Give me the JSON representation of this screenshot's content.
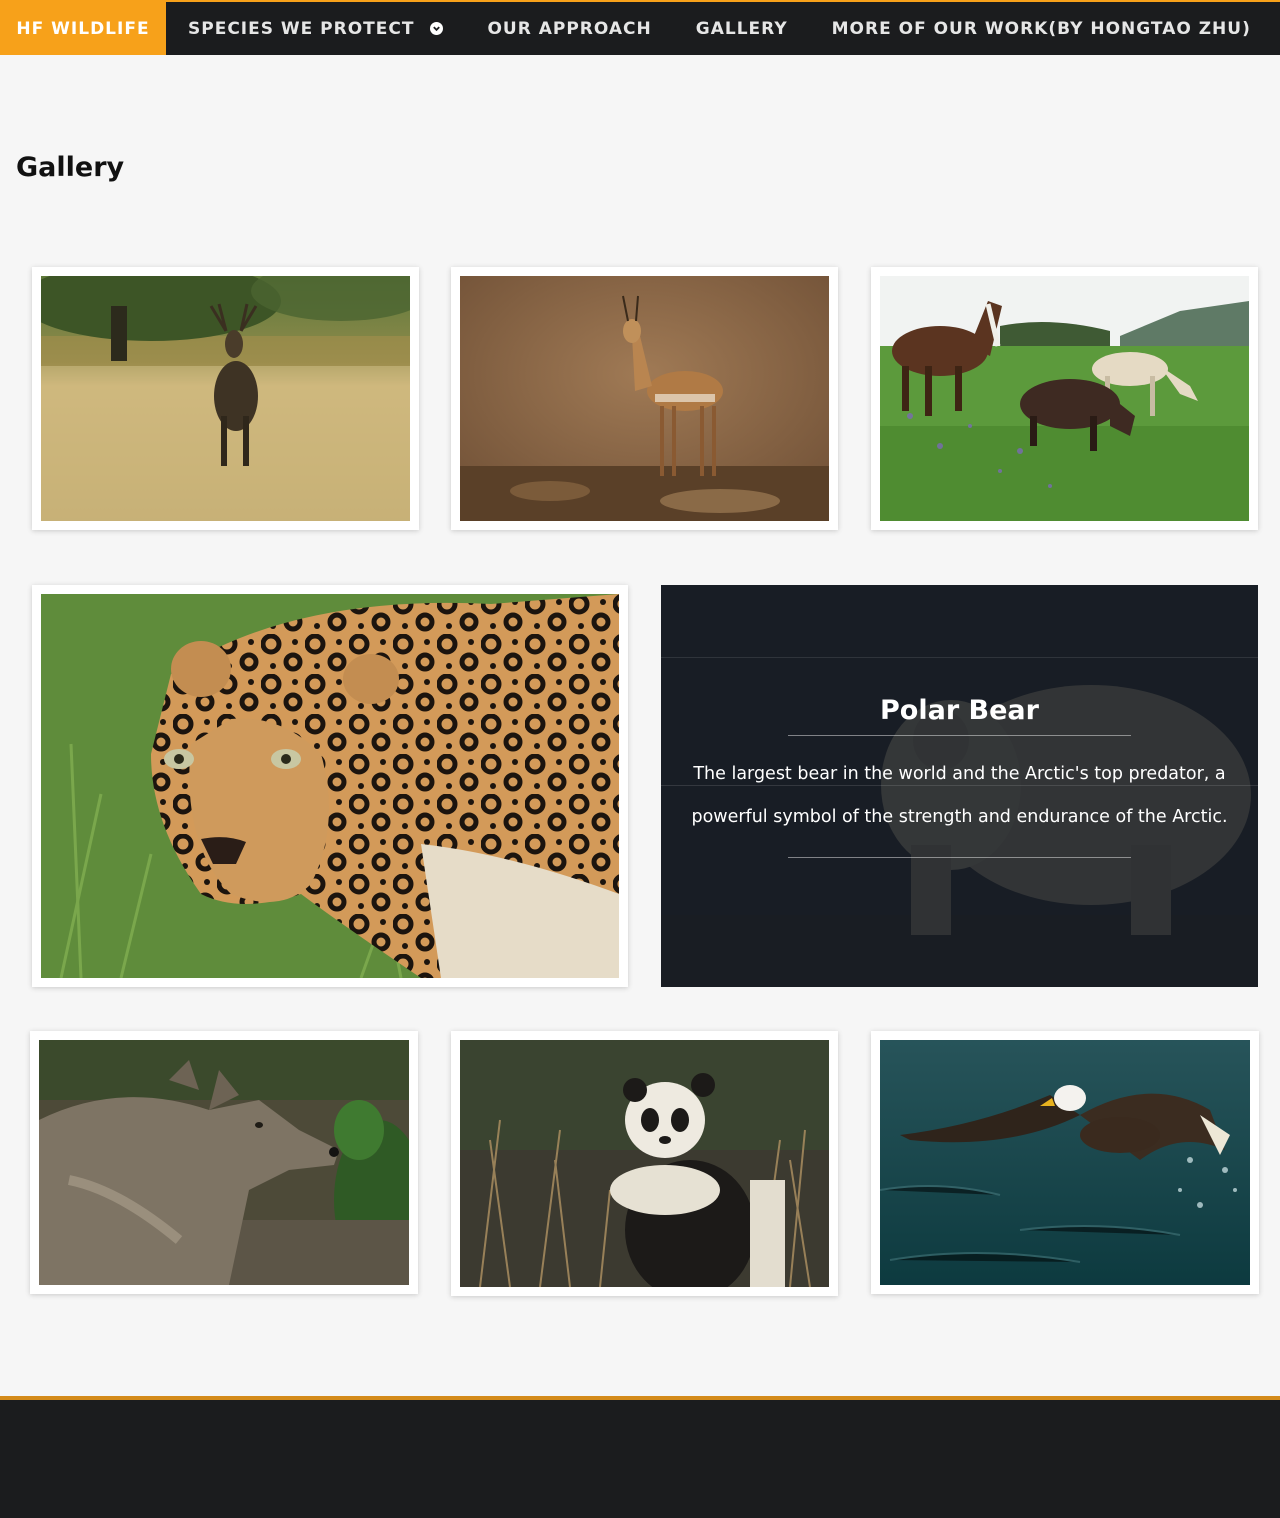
{
  "nav": {
    "brand": "HF WILDLIFE",
    "items": [
      {
        "label": "SPECIES WE PROTECT",
        "has_dropdown": true
      },
      {
        "label": "OUR APPROACH"
      },
      {
        "label": "GALLERY"
      },
      {
        "label": "MORE OF OUR WORK(BY HONGTAO ZHU)"
      }
    ],
    "accent_color": "#f7a11a",
    "background_color": "#1b1c1e"
  },
  "page": {
    "title": "Gallery"
  },
  "gallery": {
    "featured": {
      "title": "Polar Bear",
      "description": "The largest bear in the world and the Arctic's top predator, a powerful symbol of the strength and endurance of the Arctic."
    }
  }
}
